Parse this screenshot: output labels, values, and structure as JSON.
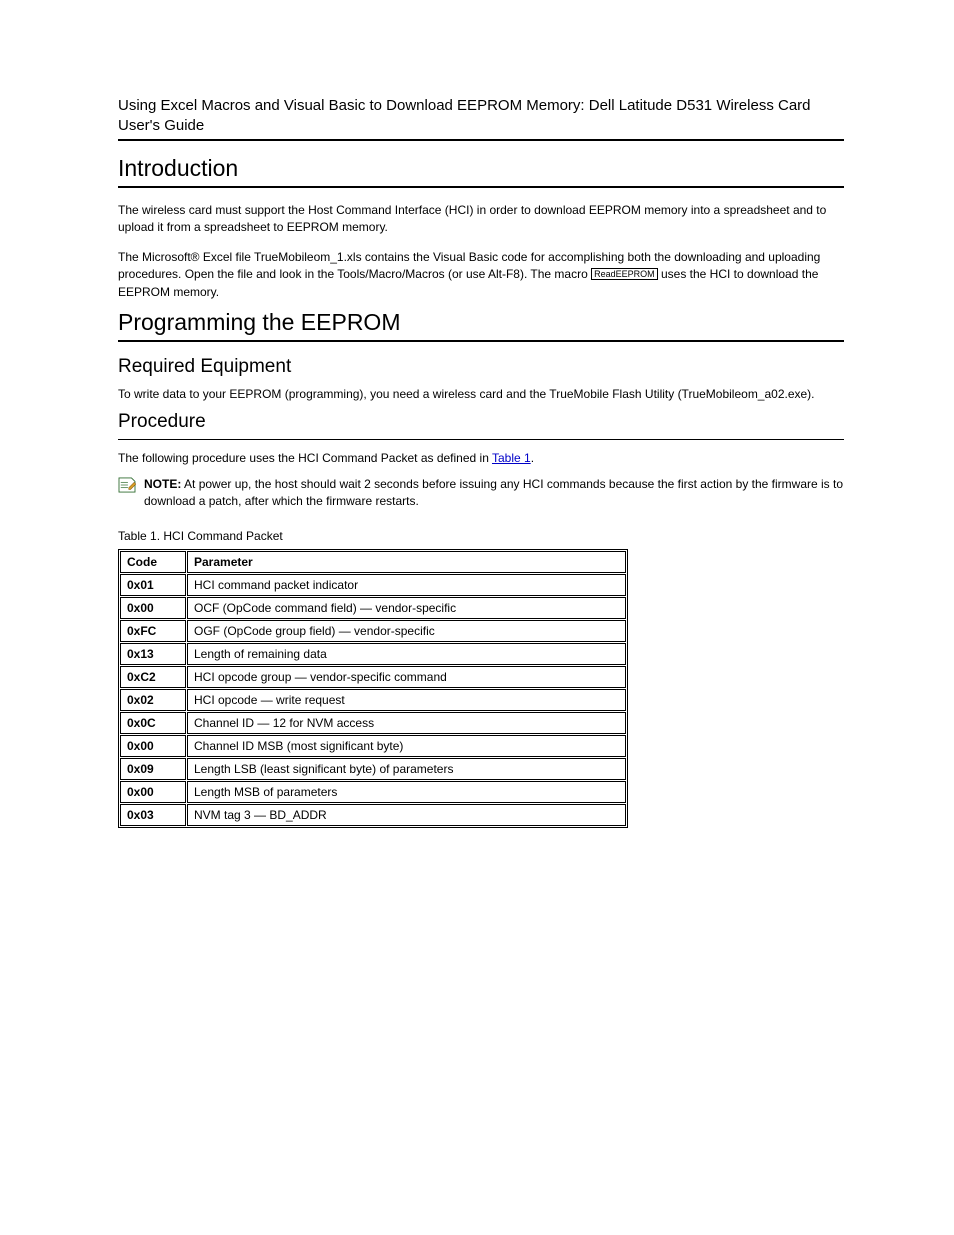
{
  "header": {
    "title": "Using Excel Macros and Visual Basic to Download EEPROM Memory: Dell Latitude D531 Wireless Card User's Guide"
  },
  "sections": {
    "introduction": {
      "heading": "Introduction",
      "p1": "The wireless card must support the Host Command Interface (HCI) in order to download EEPROM memory into a spreadsheet and to upload it from a spreadsheet to EEPROM memory.",
      "p2_before_macro": "The Microsoft® Excel file TrueMobileom_1.xls contains the Visual Basic code for accomplishing both the downloading and uploading procedures. Open the file and look in the Tools/Macro/Macros (or use Alt-F8). The macro ",
      "macro_box": "ReadEEPROM",
      "p2_after_macro": " uses the HCI to download the EEPROM memory."
    },
    "programming": {
      "heading": "Programming the EEPROM",
      "subheading": "Required Equipment",
      "p1": "To write data to your EEPROM (programming), you need a wireless card and the TrueMobile Flash Utility (TrueMobileom_a02.exe)."
    },
    "procedure": {
      "subheading": "Procedure",
      "p1_before_link": "The following procedure uses the HCI Command Packet as defined in ",
      "link_text": "Table 1",
      "p1_after_link": "."
    },
    "note": {
      "label": "NOTE:",
      "text": " At power up, the host should wait 2 seconds before issuing any HCI commands because the first action by the firmware is to download a patch, after which the firmware restarts."
    },
    "table": {
      "title": "Table 1. HCI Command Packet",
      "headers": {
        "col1": "Code",
        "col2": "Parameter"
      },
      "rows": [
        {
          "code": "0x01",
          "param": "HCI command packet indicator"
        },
        {
          "code": "0x00",
          "param": "OCF (OpCode command field) — vendor-specific"
        },
        {
          "code": "0xFC",
          "param": "OGF (OpCode group field) — vendor-specific"
        },
        {
          "code": "0x13",
          "param": "Length of remaining data"
        },
        {
          "code": "0xC2",
          "param": "HCI opcode group — vendor-specific command"
        },
        {
          "code": "0x02",
          "param": "HCI opcode  — write request"
        },
        {
          "code": "0x0C",
          "param": "Channel ID — 12 for NVM access"
        },
        {
          "code": "0x00",
          "param": "Channel ID MSB (most significant byte)"
        },
        {
          "code": "0x09",
          "param": "Length LSB (least significant byte) of parameters"
        },
        {
          "code": "0x00",
          "param": "Length MSB of parameters"
        },
        {
          "code": "0x03",
          "param": "NVM tag 3 — BD_ADDR"
        }
      ]
    }
  }
}
